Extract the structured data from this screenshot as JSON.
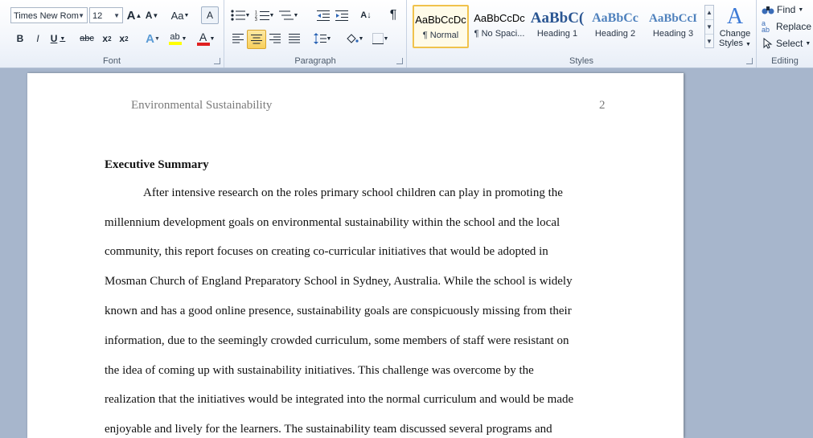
{
  "ribbon": {
    "font": {
      "label": "Font",
      "font_name": "Times New Rom",
      "font_size": "12",
      "grow_glyph": "A",
      "shrink_glyph": "A",
      "case_glyph": "Aa",
      "clear_glyph": "A",
      "bold": "B",
      "italic": "I",
      "underline": "U",
      "strike": "abc",
      "subscript": "x",
      "superscript": "x",
      "effects_glyph": "A",
      "highlight_glyph": "ab",
      "color_glyph": "A"
    },
    "paragraph": {
      "label": "Paragraph",
      "pilcrow": "¶",
      "sort_glyph": "A↓"
    },
    "styles": {
      "label": "Styles",
      "items": [
        {
          "preview": "AaBbCcDc",
          "name": "¶ Normal"
        },
        {
          "preview": "AaBbCcDc",
          "name": "¶ No Spaci..."
        },
        {
          "preview": "AaBbC(",
          "name": "Heading 1"
        },
        {
          "preview": "AaBbCc",
          "name": "Heading 2"
        },
        {
          "preview": "AaBbCcI",
          "name": "Heading 3"
        }
      ],
      "change_styles_line1": "Change",
      "change_styles_line2": "Styles"
    },
    "editing": {
      "label": "Editing",
      "find": "Find",
      "replace": "Replace",
      "select": "Select"
    },
    "colors": {
      "accent": "#f8cf5b",
      "font_color_bar": "#e02020",
      "highlight_bar": "#ffff00"
    }
  },
  "document": {
    "header_title": "Environmental Sustainability",
    "page_number": "2",
    "heading": "Executive Summary",
    "lines": [
      "After intensive research on the roles primary school children can play in promoting the",
      "millennium  development goals on environmental sustainability within the school and the local",
      "community, this report focuses on creating co-curricular initiatives that would be adopted in",
      "Mosman Church of England Preparatory School in Sydney, Australia. While the school is widely",
      "known and has a good online presence, sustainability goals are conspicuously missing from their",
      "information, due to the seemingly crowded curriculum, some members of staff were resistant on",
      "the idea of coming up with sustainability initiatives. This challenge was overcome by the",
      "realization that the initiatives would be integrated into the normal curriculum and would be made",
      "enjoyable and lively for the learners. The sustainability team discussed several programs and"
    ]
  }
}
